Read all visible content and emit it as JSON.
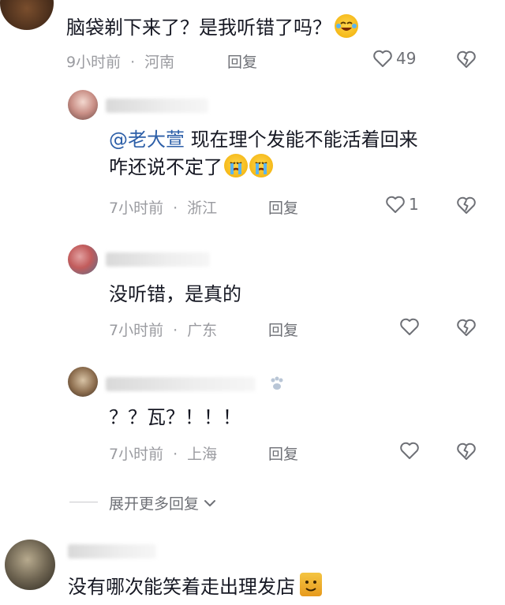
{
  "comments": [
    {
      "text": "脑袋剃下来了？是我听错了吗？",
      "time": "9小时前",
      "location": "河南",
      "reply_label": "回复",
      "likes": "49"
    }
  ],
  "replies": [
    {
      "mention": "@老大萱",
      "text_line1": " 现在理个发能不能活着回来",
      "text_line2": "咋还说不定了",
      "time": "7小时前",
      "location": "浙江",
      "reply_label": "回复",
      "likes": "1"
    },
    {
      "text": "没听错，是真的",
      "time": "7小时前",
      "location": "广东",
      "reply_label": "回复"
    },
    {
      "text": "？？瓦？！！！",
      "time": "7小时前",
      "location": "上海",
      "reply_label": "回复"
    }
  ],
  "expand_more_label": "展开更多回复",
  "bottom_comment": {
    "text": "没有哪次能笑着走出理发店"
  },
  "icons": {
    "like": "heart-outline-icon",
    "dislike": "broken-heart-icon",
    "expand": "chevron-down-icon"
  },
  "colors": {
    "text": "#161823",
    "meta": "#9a9ba0",
    "mention": "#2d5fa8"
  }
}
